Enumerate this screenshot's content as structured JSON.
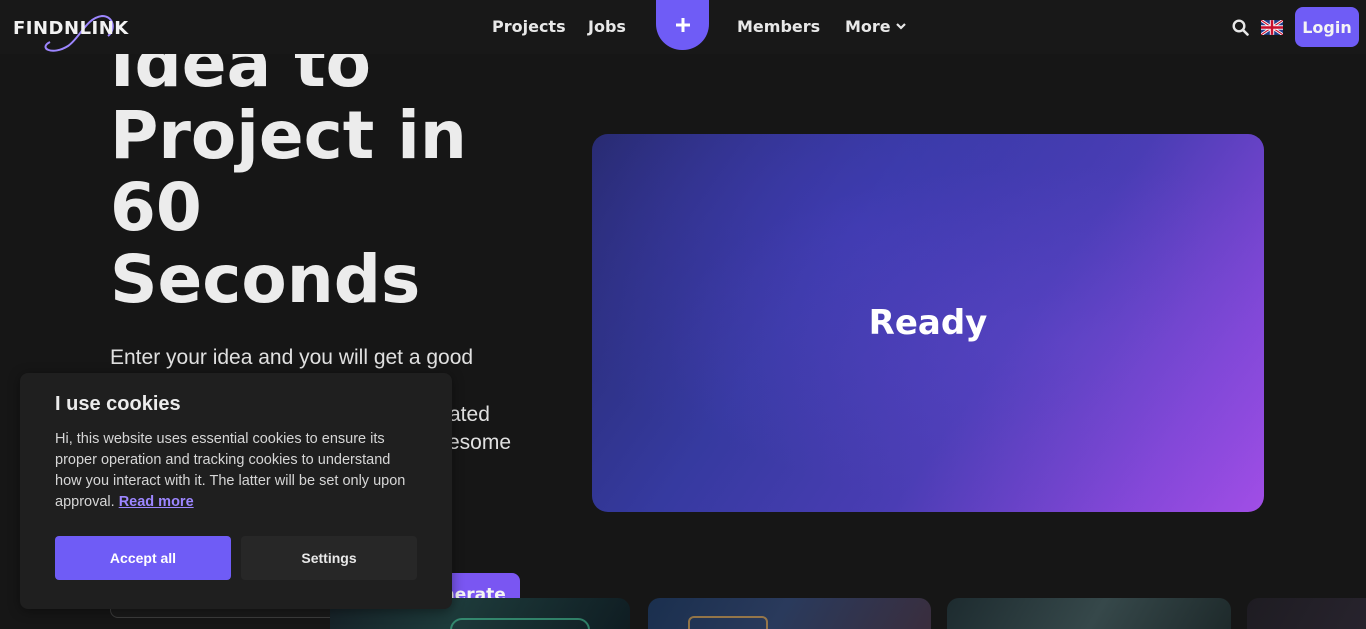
{
  "nav": {
    "logo_text": "FINDNLINK",
    "links": [
      "Projects",
      "Jobs",
      "Members",
      "More"
    ],
    "create_icon": "plus-icon",
    "search_icon": "search-icon",
    "language_icon": "uk-flag-icon",
    "login_label": "Login"
  },
  "hero": {
    "title_lines": [
      "Idea to",
      "Project in",
      "60",
      "Seconds"
    ],
    "subtitle_lines": [
      "Enter your idea and you will get a good",
      "",
      "ated",
      "esome"
    ],
    "ready_label": "Ready",
    "generate_label": "Generate",
    "accent_color": "#6f5cf6"
  },
  "cookie": {
    "title": "I use cookies",
    "text": "Hi, this website uses essential cookies to ensure its proper operation and tracking cookies to understand how you interact with it. The latter will be set only upon approval.",
    "read_more": "Read more",
    "accept_label": "Accept all",
    "settings_label": "Settings"
  }
}
